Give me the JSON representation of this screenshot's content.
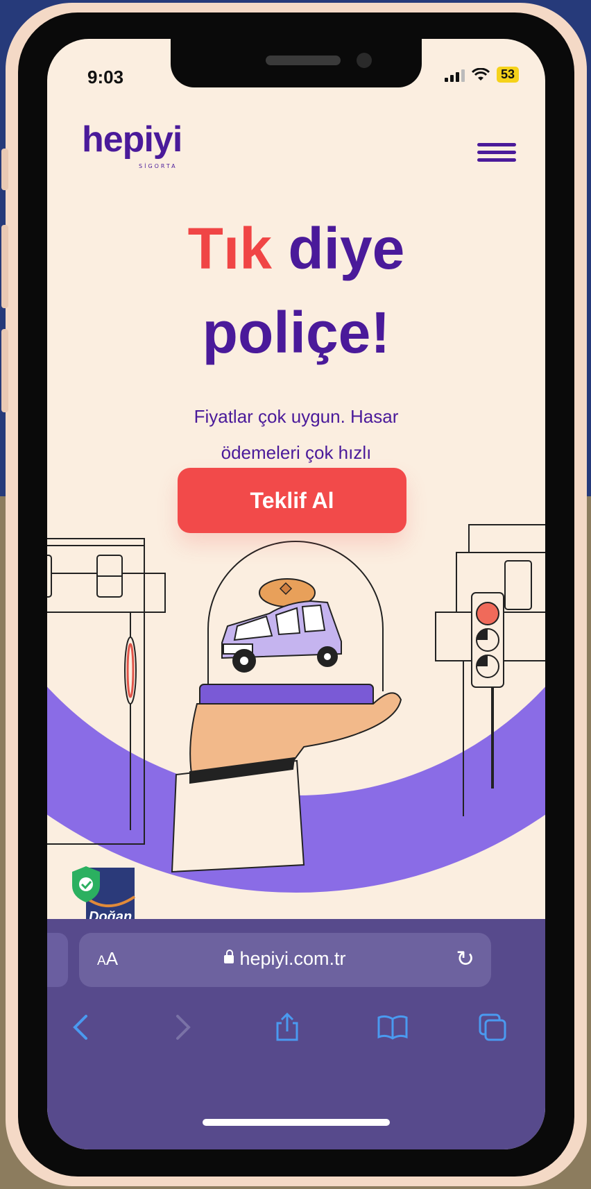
{
  "status_bar": {
    "time": "9:03",
    "battery": "53"
  },
  "brand": {
    "name": "hepiyi",
    "tagline": "SİGORTA"
  },
  "hero": {
    "title_part1": "Tık",
    "title_part2": "diye",
    "title_line2": "poliçe!",
    "subtitle_line1": "Fiyatlar çok uygun. Hasar",
    "subtitle_line2": "ödemeleri çok hızlı",
    "cta_label": "Teklif Al"
  },
  "badge": {
    "text": "Doğan"
  },
  "browser": {
    "aa_small": "A",
    "aa_large": "A",
    "url": "hepiyi.com.tr"
  },
  "colors": {
    "brand_purple": "#4a1a9a",
    "accent_red": "#f24a4a",
    "arc_purple": "#8a6ce6",
    "page_bg": "#fbeee0"
  }
}
